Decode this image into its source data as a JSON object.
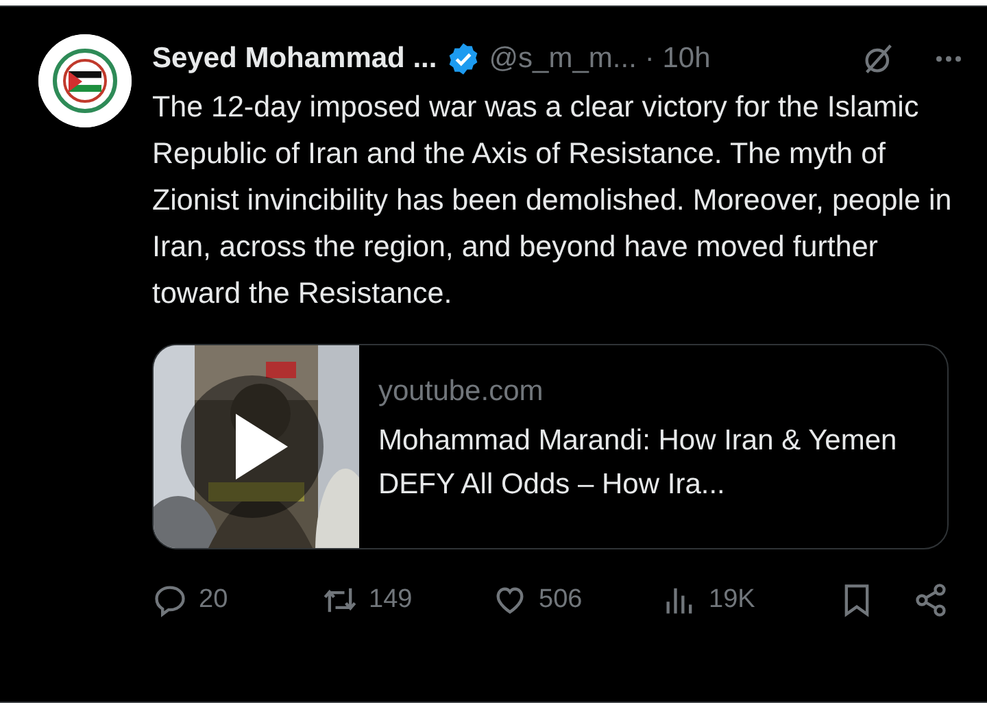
{
  "post": {
    "author": "Seyed Mohammad ...",
    "verified": true,
    "handle": "@s_m_m...",
    "time": "· 10h",
    "text": "The 12-day imposed war was a clear victory for the Islamic Republic of Iran and the Axis of Resistance. The myth of Zionist invincibility has been demolished. Moreover, people in Iran, across the region, and beyond have moved further toward the Resistance.",
    "link_card": {
      "domain": "youtube.com",
      "title": "Mohammad Marandi: How Iran & Yemen DEFY All Odds – How Ira..."
    },
    "actions": [
      {
        "kind": "reply",
        "count": "20"
      },
      {
        "kind": "repost",
        "count": "149"
      },
      {
        "kind": "like",
        "count": "506"
      },
      {
        "kind": "views",
        "count": "19K"
      }
    ]
  }
}
